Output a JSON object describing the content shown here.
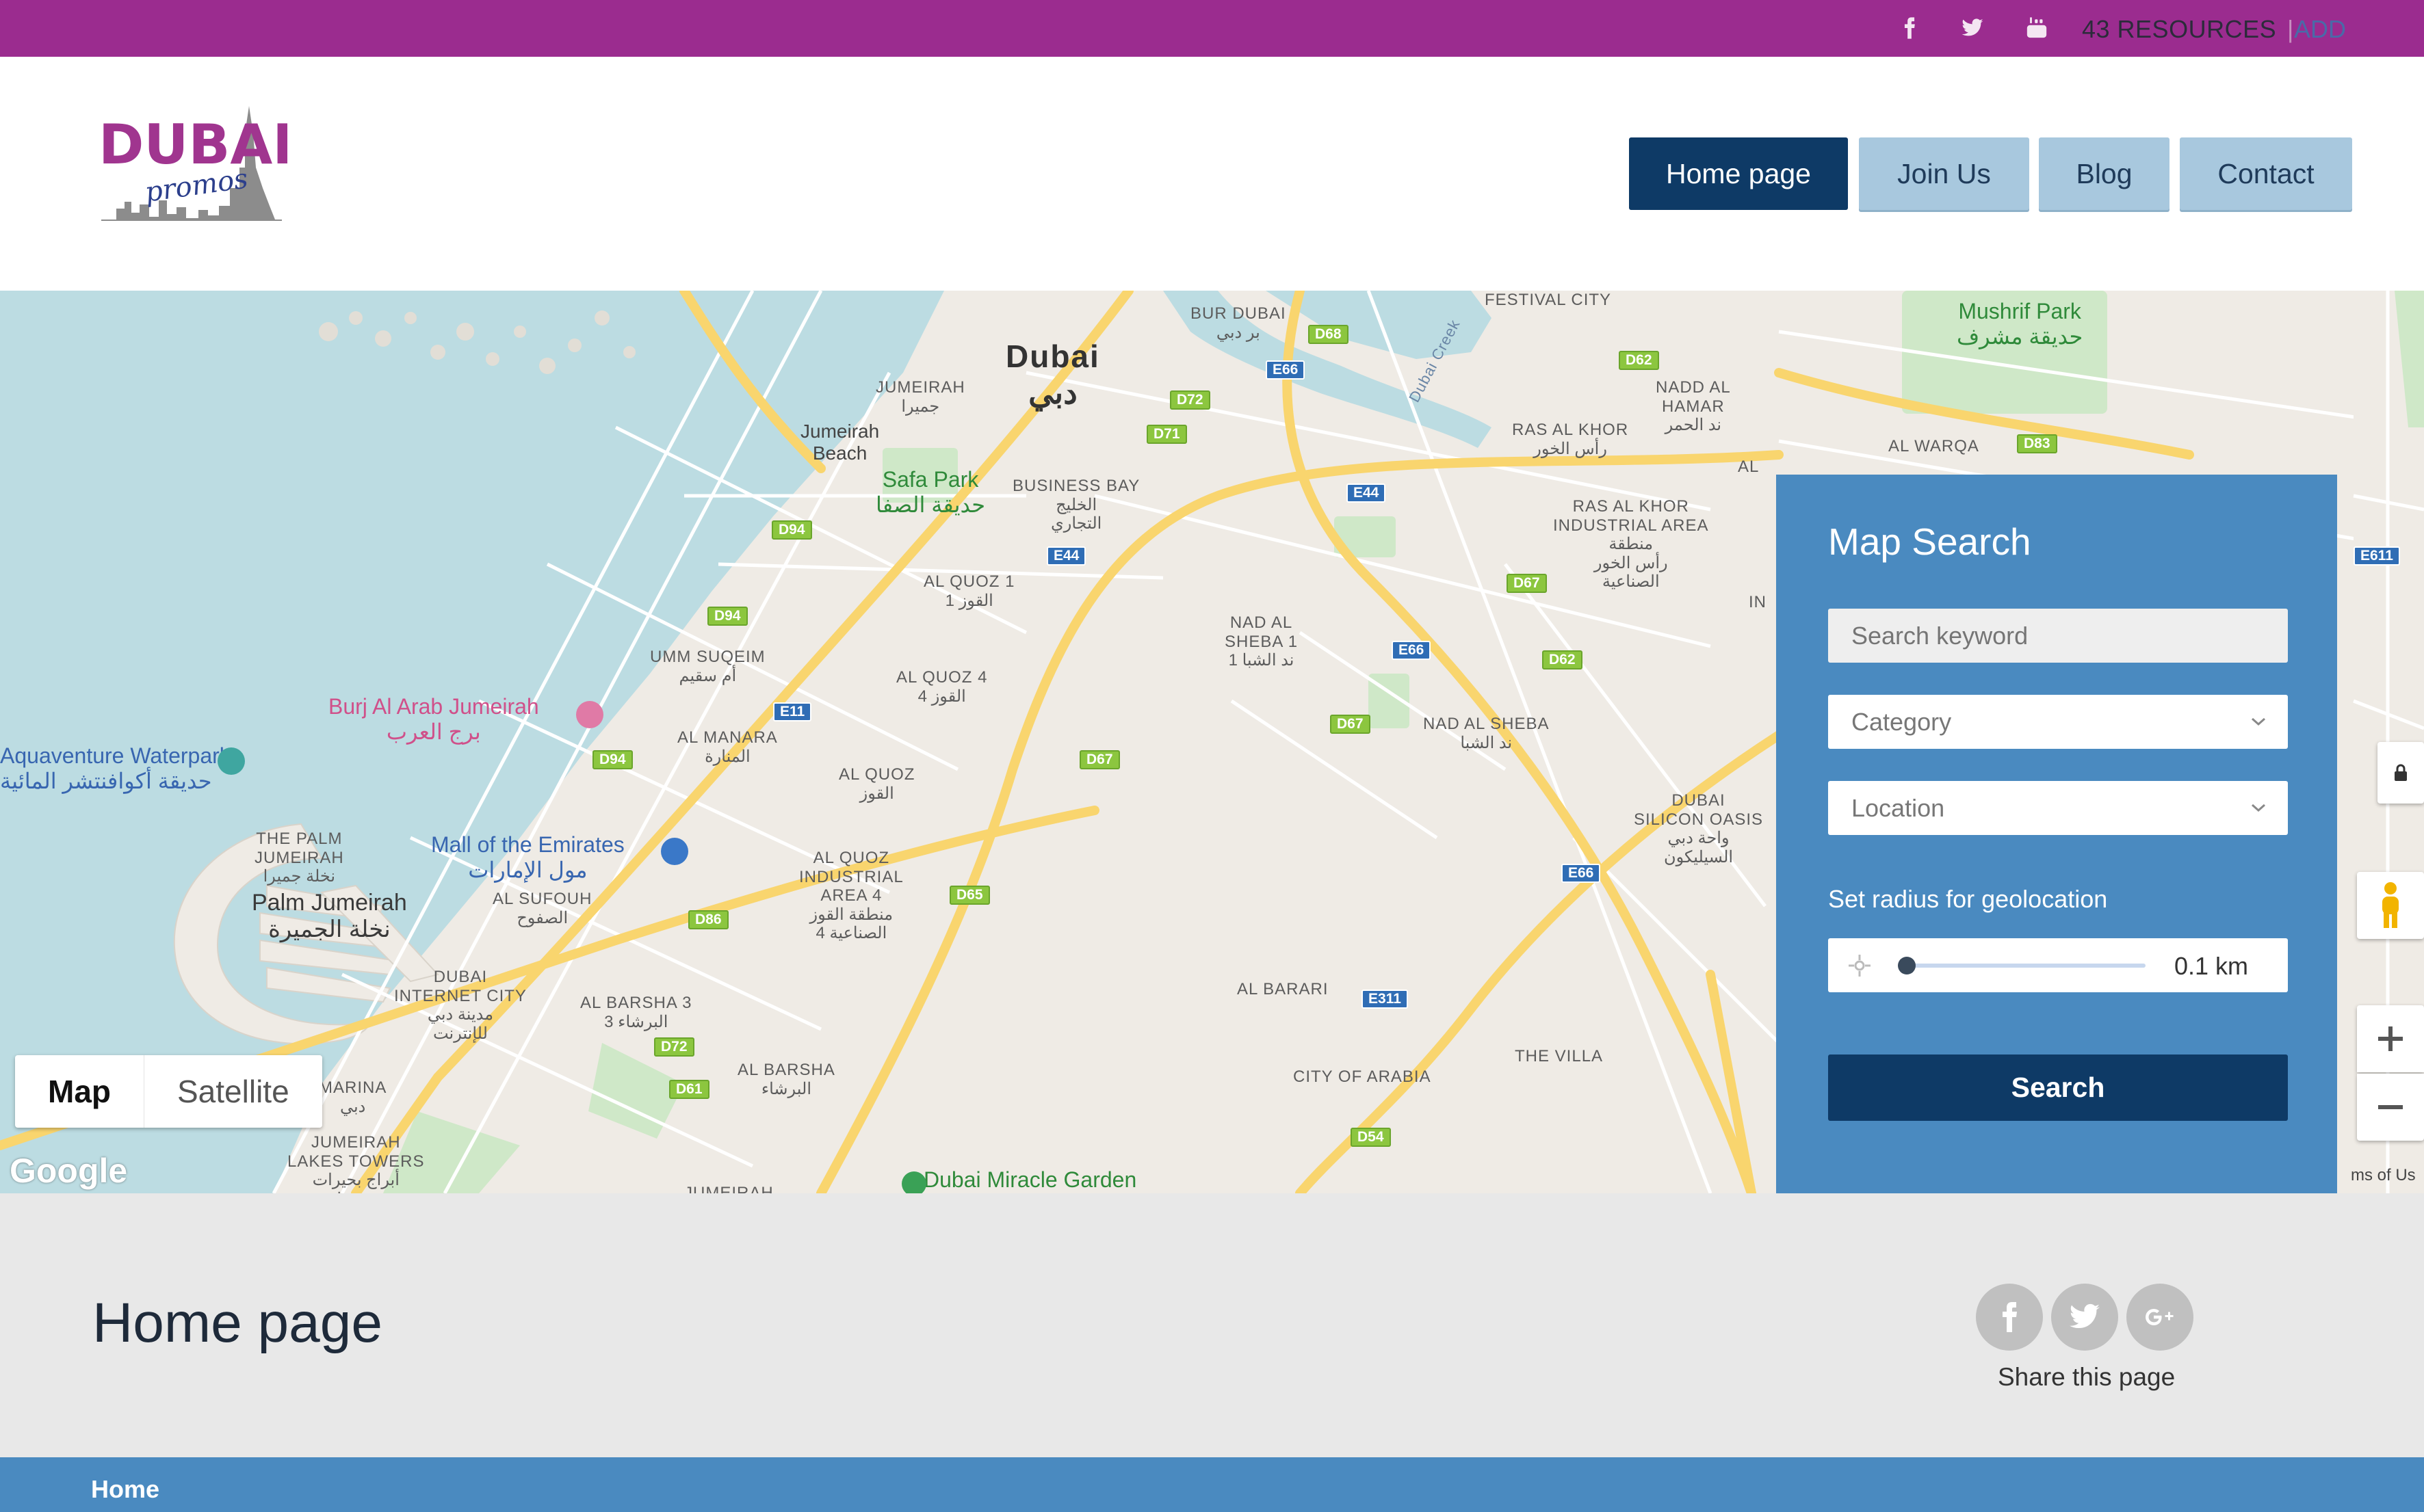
{
  "topbar": {
    "social": [
      "facebook-icon",
      "twitter-icon",
      "youtube-icon"
    ],
    "resources": "43 RESOURCES",
    "separator": "|",
    "add": "ADD"
  },
  "brand": {
    "logo_main": "DUBAI",
    "logo_sub": "promos"
  },
  "nav": [
    {
      "label": "Home page",
      "active": true
    },
    {
      "label": "Join Us",
      "active": false
    },
    {
      "label": "Blog",
      "active": false
    },
    {
      "label": "Contact",
      "active": false
    }
  ],
  "map": {
    "type_map": "Map",
    "type_satellite": "Satellite",
    "attribution": "Google",
    "terms": "ms of Us",
    "labels": {
      "dubai": "Dubai\nدبي",
      "jumeirah": "JUMEIRAH\nجميرا",
      "jumeirah_beach": "Jumeirah\nBeach",
      "safa_park": "Safa Park\nحديقة الصفا",
      "business_bay": "BUSINESS BAY\nالخليج\nالتجاري",
      "bur_dubai": "BUR DUBAI\nبر دبي",
      "dubai_creek": "Dubai Creek",
      "nadd_al_hamar": "NADD AL\nHAMAR\nند الحمر",
      "ras_al_khor": "RAS AL KHOR\nرأس الخور",
      "ras_al_khor_ind": "RAS AL KHOR\nINDUSTRIAL AREA\nمنطقة\nرأس الخور\nالصناعية",
      "mushrif_park": "Mushrif Park\nحديقة مشرف",
      "al_warqa": "AL WARQA",
      "al_quoz_1": "AL QUOZ 1\nالقوز 1",
      "nad_al_sheba_1": "NAD AL\nSHEBA 1\nند الشبا 1",
      "umm_suqeim": "UMM SUQEIM\nأم سقيم",
      "al_quoz_4": "AL QUOZ 4\nالقوز 4",
      "burj_al_arab": "Burj Al Arab Jumeirah\nبرج العرب",
      "al_manara": "AL MANARA\nالمنارة",
      "al_quoz": "AL QUOZ\nالقوز",
      "nad_al_sheba": "NAD AL SHEBA\nند الشبا",
      "waterpark": "Aquaventure Waterpark\nحديقة أكوافنتشر المائية",
      "palm": "THE PALM\nJUMEIRAH\nنخلة جميرا",
      "palm_jumeirah": "Palm Jumeirah\nنخلة الجميرة",
      "mall": "Mall of the Emirates\nمول الإمارات",
      "al_sufouh": "AL SUFOUH\nالصفوح",
      "al_quoz_ind_4": "AL QUOZ\nINDUSTRIAL\nAREA 4\nمنطقة القوز\nالصناعية 4",
      "silicon_oasis": "DUBAI\nSILICON OASIS\nواحة دبي\nالسيليكون",
      "internet_city": "DUBAI\nINTERNET CITY\nمدينة دبي\nللإنترنت",
      "al_barsha_3": "AL BARSHA 3\nالبرشاء 3",
      "al_barari": "AL BARARI",
      "marina": "MARINA\nدبي",
      "al_barsha": "AL BARSHA\nالبرشاء",
      "city_of_arabia": "CITY OF ARABIA",
      "the_villa": "THE VILLA",
      "lakes_towers": "JUMEIRAH\nLAKES TOWERS\nأبراج بحيرات\nجميرا",
      "jumeirah_bottom": "JUMEIRAH",
      "miracle_garden": "Dubai Miracle Garden",
      "festival_city": "FESTIVAL CITY",
      "al_edge": "AL",
      "in_edge": "IN"
    },
    "shields": [
      "D68",
      "E66",
      "D72",
      "D71",
      "D62",
      "D83",
      "D94",
      "E44",
      "E44",
      "D67",
      "E611",
      "D94",
      "E66",
      "D62",
      "E11",
      "D67",
      "D67",
      "D94",
      "E66",
      "D86",
      "D65",
      "E311",
      "D72",
      "D61",
      "D54"
    ]
  },
  "search_panel": {
    "title": "Map Search",
    "keyword_placeholder": "Search keyword",
    "category": "Category",
    "location": "Location",
    "radius_label": "Set radius for geolocation",
    "radius_value": "0.1 km",
    "radius_fraction": 0.0,
    "search_label": "Search"
  },
  "page": {
    "title": "Home page",
    "share_label": "Share this page",
    "share_icons": [
      "facebook-icon",
      "twitter-icon",
      "google-plus-icon"
    ]
  },
  "breadcrumb": {
    "home": "Home"
  }
}
